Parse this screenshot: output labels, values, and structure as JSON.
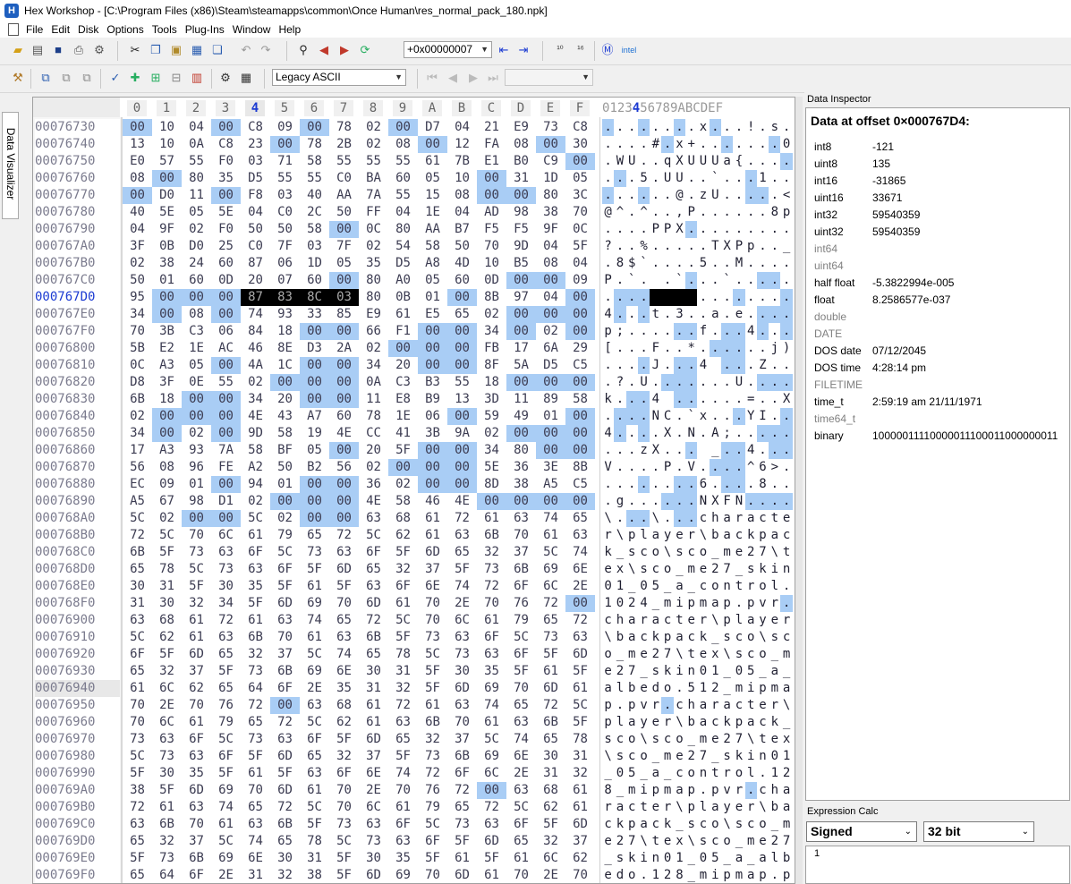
{
  "window": {
    "app_icon_letter": "H",
    "title": "Hex Workshop - [C:\\Program Files (x86)\\Steam\\steamapps\\common\\Once Human\\res_normal_pack_180.npk]"
  },
  "menu": [
    "File",
    "Edit",
    "Disk",
    "Options",
    "Tools",
    "Plug-Ins",
    "Window",
    "Help"
  ],
  "toolbar": {
    "goto_value": "+0x00000007",
    "encoding": "Legacy ASCII"
  },
  "left_tab": "Data Visualizer",
  "hex_view": {
    "column_headers": [
      "0",
      "1",
      "2",
      "3",
      "4",
      "5",
      "6",
      "7",
      "8",
      "9",
      "A",
      "B",
      "C",
      "D",
      "E",
      "F"
    ],
    "selected_column": "4",
    "ascii_header": "0123456789ABCDEF",
    "current_address": "000767D0",
    "marked_address": "00076940",
    "rows": [
      {
        "addr": "00076730",
        "hex": [
          "00",
          "10",
          "04",
          "00",
          "C8",
          "09",
          "00",
          "78",
          "02",
          "00",
          "D7",
          "04",
          "21",
          "E9",
          "73",
          "C8"
        ],
        "ascii": "........x...!.s."
      },
      {
        "addr": "00076740",
        "hex": [
          "13",
          "10",
          "0A",
          "C8",
          "23",
          "00",
          "78",
          "2B",
          "02",
          "08",
          "00",
          "12",
          "FA",
          "08",
          "00",
          "30"
        ],
        "ascii": "....#.x+.......0"
      },
      {
        "addr": "00076750",
        "hex": [
          "E0",
          "57",
          "55",
          "F0",
          "03",
          "71",
          "58",
          "55",
          "55",
          "55",
          "61",
          "7B",
          "E1",
          "B0",
          "C9",
          "00"
        ],
        "ascii": ".WU..qXUUUa{...."
      },
      {
        "addr": "00076760",
        "hex": [
          "08",
          "00",
          "80",
          "35",
          "D5",
          "55",
          "55",
          "C0",
          "BA",
          "60",
          "05",
          "10",
          "00",
          "31",
          "1D",
          "05"
        ],
        "ascii": "...5.UU..`...1.."
      },
      {
        "addr": "00076770",
        "hex": [
          "00",
          "D0",
          "11",
          "00",
          "F8",
          "03",
          "40",
          "AA",
          "7A",
          "55",
          "15",
          "08",
          "00",
          "00",
          "80",
          "3C"
        ],
        "ascii": "......@.zU.....<"
      },
      {
        "addr": "00076780",
        "hex": [
          "40",
          "5E",
          "05",
          "5E",
          "04",
          "C0",
          "2C",
          "50",
          "FF",
          "04",
          "1E",
          "04",
          "AD",
          "98",
          "38",
          "70"
        ],
        "ascii": "@^.^..,P......8p"
      },
      {
        "addr": "00076790",
        "hex": [
          "04",
          "9F",
          "02",
          "F0",
          "50",
          "50",
          "58",
          "00",
          "0C",
          "80",
          "AA",
          "B7",
          "F5",
          "F5",
          "9F",
          "0C"
        ],
        "ascii": "....PPX........."
      },
      {
        "addr": "000767A0",
        "hex": [
          "3F",
          "0B",
          "D0",
          "25",
          "C0",
          "7F",
          "03",
          "7F",
          "02",
          "54",
          "58",
          "50",
          "70",
          "9D",
          "04",
          "5F"
        ],
        "ascii": "?..%.....TXPp.._"
      },
      {
        "addr": "000767B0",
        "hex": [
          "02",
          "38",
          "24",
          "60",
          "87",
          "06",
          "1D",
          "05",
          "35",
          "D5",
          "A8",
          "4D",
          "10",
          "B5",
          "08",
          "04"
        ],
        "ascii": ".8$`....5..M...."
      },
      {
        "addr": "000767C0",
        "hex": [
          "50",
          "01",
          "60",
          "0D",
          "20",
          "07",
          "60",
          "00",
          "80",
          "A0",
          "05",
          "60",
          "0D",
          "00",
          "00",
          "09"
        ],
        "ascii": "P.`. .`...`....."
      },
      {
        "addr": "000767D0",
        "hex": [
          "95",
          "00",
          "00",
          "00",
          "87",
          "83",
          "8C",
          "03",
          "80",
          "0B",
          "01",
          "00",
          "8B",
          "97",
          "04",
          "00"
        ],
        "ascii": "................"
      },
      {
        "addr": "000767E0",
        "hex": [
          "34",
          "00",
          "08",
          "00",
          "74",
          "93",
          "33",
          "85",
          "E9",
          "61",
          "E5",
          "65",
          "02",
          "00",
          "00",
          "00"
        ],
        "ascii": "4...t.3..a.e...."
      },
      {
        "addr": "000767F0",
        "hex": [
          "70",
          "3B",
          "C3",
          "06",
          "84",
          "18",
          "00",
          "00",
          "66",
          "F1",
          "00",
          "00",
          "34",
          "00",
          "02",
          "00"
        ],
        "ascii": "p;......f...4..."
      },
      {
        "addr": "00076800",
        "hex": [
          "5B",
          "E2",
          "1E",
          "AC",
          "46",
          "8E",
          "D3",
          "2A",
          "02",
          "00",
          "00",
          "00",
          "FB",
          "17",
          "6A",
          "29"
        ],
        "ascii": "[...F..*......j)"
      },
      {
        "addr": "00076810",
        "hex": [
          "0C",
          "A3",
          "05",
          "00",
          "4A",
          "1C",
          "00",
          "00",
          "34",
          "20",
          "00",
          "00",
          "8F",
          "5A",
          "D5",
          "C5"
        ],
        "ascii": "....J...4 ...Z.."
      },
      {
        "addr": "00076820",
        "hex": [
          "D8",
          "3F",
          "0E",
          "55",
          "02",
          "00",
          "00",
          "00",
          "0A",
          "C3",
          "B3",
          "55",
          "18",
          "00",
          "00",
          "00"
        ],
        "ascii": ".?.U.......U...."
      },
      {
        "addr": "00076830",
        "hex": [
          "6B",
          "18",
          "00",
          "00",
          "34",
          "20",
          "00",
          "00",
          "11",
          "E8",
          "B9",
          "13",
          "3D",
          "11",
          "89",
          "58"
        ],
        "ascii": "k...4 ......=..X"
      },
      {
        "addr": "00076840",
        "hex": [
          "02",
          "00",
          "00",
          "00",
          "4E",
          "43",
          "A7",
          "60",
          "78",
          "1E",
          "06",
          "00",
          "59",
          "49",
          "01",
          "00"
        ],
        "ascii": "....NC.`x...YI.."
      },
      {
        "addr": "00076850",
        "hex": [
          "34",
          "00",
          "02",
          "00",
          "9D",
          "58",
          "19",
          "4E",
          "CC",
          "41",
          "3B",
          "9A",
          "02",
          "00",
          "00",
          "00"
        ],
        "ascii": "4....X.N.A;....."
      },
      {
        "addr": "00076860",
        "hex": [
          "17",
          "A3",
          "93",
          "7A",
          "58",
          "BF",
          "05",
          "00",
          "20",
          "5F",
          "00",
          "00",
          "34",
          "80",
          "00",
          "00"
        ],
        "ascii": "...zX... _..4..."
      },
      {
        "addr": "00076870",
        "hex": [
          "56",
          "08",
          "96",
          "FE",
          "A2",
          "50",
          "B2",
          "56",
          "02",
          "00",
          "00",
          "00",
          "5E",
          "36",
          "3E",
          "8B"
        ],
        "ascii": "V....P.V....^6>."
      },
      {
        "addr": "00076880",
        "hex": [
          "EC",
          "09",
          "01",
          "00",
          "94",
          "01",
          "00",
          "00",
          "36",
          "02",
          "00",
          "00",
          "8D",
          "38",
          "A5",
          "C5"
        ],
        "ascii": "........6....8.."
      },
      {
        "addr": "00076890",
        "hex": [
          "A5",
          "67",
          "98",
          "D1",
          "02",
          "00",
          "00",
          "00",
          "4E",
          "58",
          "46",
          "4E",
          "00",
          "00",
          "00",
          "00"
        ],
        "ascii": ".g......NXFN...."
      },
      {
        "addr": "000768A0",
        "hex": [
          "5C",
          "02",
          "00",
          "00",
          "5C",
          "02",
          "00",
          "00",
          "63",
          "68",
          "61",
          "72",
          "61",
          "63",
          "74",
          "65"
        ],
        "ascii": "\\...\\...characte"
      },
      {
        "addr": "000768B0",
        "hex": [
          "72",
          "5C",
          "70",
          "6C",
          "61",
          "79",
          "65",
          "72",
          "5C",
          "62",
          "61",
          "63",
          "6B",
          "70",
          "61",
          "63"
        ],
        "ascii": "r\\player\\backpac"
      },
      {
        "addr": "000768C0",
        "hex": [
          "6B",
          "5F",
          "73",
          "63",
          "6F",
          "5C",
          "73",
          "63",
          "6F",
          "5F",
          "6D",
          "65",
          "32",
          "37",
          "5C",
          "74"
        ],
        "ascii": "k_sco\\sco_me27\\t"
      },
      {
        "addr": "000768D0",
        "hex": [
          "65",
          "78",
          "5C",
          "73",
          "63",
          "6F",
          "5F",
          "6D",
          "65",
          "32",
          "37",
          "5F",
          "73",
          "6B",
          "69",
          "6E"
        ],
        "ascii": "ex\\sco_me27_skin"
      },
      {
        "addr": "000768E0",
        "hex": [
          "30",
          "31",
          "5F",
          "30",
          "35",
          "5F",
          "61",
          "5F",
          "63",
          "6F",
          "6E",
          "74",
          "72",
          "6F",
          "6C",
          "2E"
        ],
        "ascii": "01_05_a_control."
      },
      {
        "addr": "000768F0",
        "hex": [
          "31",
          "30",
          "32",
          "34",
          "5F",
          "6D",
          "69",
          "70",
          "6D",
          "61",
          "70",
          "2E",
          "70",
          "76",
          "72",
          "00"
        ],
        "ascii": "1024_mipmap.pvr."
      },
      {
        "addr": "00076900",
        "hex": [
          "63",
          "68",
          "61",
          "72",
          "61",
          "63",
          "74",
          "65",
          "72",
          "5C",
          "70",
          "6C",
          "61",
          "79",
          "65",
          "72"
        ],
        "ascii": "character\\player"
      },
      {
        "addr": "00076910",
        "hex": [
          "5C",
          "62",
          "61",
          "63",
          "6B",
          "70",
          "61",
          "63",
          "6B",
          "5F",
          "73",
          "63",
          "6F",
          "5C",
          "73",
          "63"
        ],
        "ascii": "\\backpack_sco\\sc"
      },
      {
        "addr": "00076920",
        "hex": [
          "6F",
          "5F",
          "6D",
          "65",
          "32",
          "37",
          "5C",
          "74",
          "65",
          "78",
          "5C",
          "73",
          "63",
          "6F",
          "5F",
          "6D"
        ],
        "ascii": "o_me27\\tex\\sco_m"
      },
      {
        "addr": "00076930",
        "hex": [
          "65",
          "32",
          "37",
          "5F",
          "73",
          "6B",
          "69",
          "6E",
          "30",
          "31",
          "5F",
          "30",
          "35",
          "5F",
          "61",
          "5F"
        ],
        "ascii": "e27_skin01_05_a_"
      },
      {
        "addr": "00076940",
        "hex": [
          "61",
          "6C",
          "62",
          "65",
          "64",
          "6F",
          "2E",
          "35",
          "31",
          "32",
          "5F",
          "6D",
          "69",
          "70",
          "6D",
          "61"
        ],
        "ascii": "albedo.512_mipma"
      },
      {
        "addr": "00076950",
        "hex": [
          "70",
          "2E",
          "70",
          "76",
          "72",
          "00",
          "63",
          "68",
          "61",
          "72",
          "61",
          "63",
          "74",
          "65",
          "72",
          "5C"
        ],
        "ascii": "p.pvr.character\\"
      },
      {
        "addr": "00076960",
        "hex": [
          "70",
          "6C",
          "61",
          "79",
          "65",
          "72",
          "5C",
          "62",
          "61",
          "63",
          "6B",
          "70",
          "61",
          "63",
          "6B",
          "5F"
        ],
        "ascii": "player\\backpack_"
      },
      {
        "addr": "00076970",
        "hex": [
          "73",
          "63",
          "6F",
          "5C",
          "73",
          "63",
          "6F",
          "5F",
          "6D",
          "65",
          "32",
          "37",
          "5C",
          "74",
          "65",
          "78"
        ],
        "ascii": "sco\\sco_me27\\tex"
      },
      {
        "addr": "00076980",
        "hex": [
          "5C",
          "73",
          "63",
          "6F",
          "5F",
          "6D",
          "65",
          "32",
          "37",
          "5F",
          "73",
          "6B",
          "69",
          "6E",
          "30",
          "31"
        ],
        "ascii": "\\sco_me27_skin01"
      },
      {
        "addr": "00076990",
        "hex": [
          "5F",
          "30",
          "35",
          "5F",
          "61",
          "5F",
          "63",
          "6F",
          "6E",
          "74",
          "72",
          "6F",
          "6C",
          "2E",
          "31",
          "32"
        ],
        "ascii": "_05_a_control.12"
      },
      {
        "addr": "000769A0",
        "hex": [
          "38",
          "5F",
          "6D",
          "69",
          "70",
          "6D",
          "61",
          "70",
          "2E",
          "70",
          "76",
          "72",
          "00",
          "63",
          "68",
          "61"
        ],
        "ascii": "8_mipmap.pvr.cha"
      },
      {
        "addr": "000769B0",
        "hex": [
          "72",
          "61",
          "63",
          "74",
          "65",
          "72",
          "5C",
          "70",
          "6C",
          "61",
          "79",
          "65",
          "72",
          "5C",
          "62",
          "61"
        ],
        "ascii": "racter\\player\\ba"
      },
      {
        "addr": "000769C0",
        "hex": [
          "63",
          "6B",
          "70",
          "61",
          "63",
          "6B",
          "5F",
          "73",
          "63",
          "6F",
          "5C",
          "73",
          "63",
          "6F",
          "5F",
          "6D"
        ],
        "ascii": "ckpack_sco\\sco_m"
      },
      {
        "addr": "000769D0",
        "hex": [
          "65",
          "32",
          "37",
          "5C",
          "74",
          "65",
          "78",
          "5C",
          "73",
          "63",
          "6F",
          "5F",
          "6D",
          "65",
          "32",
          "37"
        ],
        "ascii": "e27\\tex\\sco_me27"
      },
      {
        "addr": "000769E0",
        "hex": [
          "5F",
          "73",
          "6B",
          "69",
          "6E",
          "30",
          "31",
          "5F",
          "30",
          "35",
          "5F",
          "61",
          "5F",
          "61",
          "6C",
          "62"
        ],
        "ascii": "_skin01_05_a_alb"
      },
      {
        "addr": "000769F0",
        "hex": [
          "65",
          "64",
          "6F",
          "2E",
          "31",
          "32",
          "38",
          "5F",
          "6D",
          "69",
          "70",
          "6D",
          "61",
          "70",
          "2E",
          "70"
        ],
        "ascii": "edo.128_mipmap.p"
      }
    ]
  },
  "data_inspector": {
    "title": "Data Inspector",
    "offset_label": "Data at offset 0×000767D4:",
    "rows": [
      {
        "k": "int8",
        "v": "-121",
        "dim": false
      },
      {
        "k": "uint8",
        "v": "135",
        "dim": false
      },
      {
        "k": "int16",
        "v": "-31865",
        "dim": false
      },
      {
        "k": "uint16",
        "v": "33671",
        "dim": false
      },
      {
        "k": "int32",
        "v": "59540359",
        "dim": false
      },
      {
        "k": "uint32",
        "v": "59540359",
        "dim": false
      },
      {
        "k": "int64",
        "v": "",
        "dim": true
      },
      {
        "k": "uint64",
        "v": "",
        "dim": true
      },
      {
        "k": "half float",
        "v": "-5.3822994e-005",
        "dim": false
      },
      {
        "k": "float",
        "v": "8.2586577e-037",
        "dim": false
      },
      {
        "k": "double",
        "v": "",
        "dim": true
      },
      {
        "k": "DATE",
        "v": "",
        "dim": true
      },
      {
        "k": "DOS date",
        "v": "07/12/2045",
        "dim": false
      },
      {
        "k": "DOS time",
        "v": "4:28:14 pm",
        "dim": false
      },
      {
        "k": "FILETIME",
        "v": "",
        "dim": true
      },
      {
        "k": "time_t",
        "v": "2:59:19 am 21/11/1971",
        "dim": false
      },
      {
        "k": "time64_t",
        "v": "",
        "dim": true
      },
      {
        "k": "binary",
        "v": "10000011110000011100011000000011",
        "dim": false
      }
    ]
  },
  "expression_calc": {
    "title": "Expression Calc",
    "sign_mode": "Signed",
    "bit_width": "32 bit",
    "line_number": "1"
  },
  "colors": {
    "zero_byte_bg": "#a9cdf5",
    "selection_bg": "#000000",
    "current_address": "#1c3bd2"
  }
}
